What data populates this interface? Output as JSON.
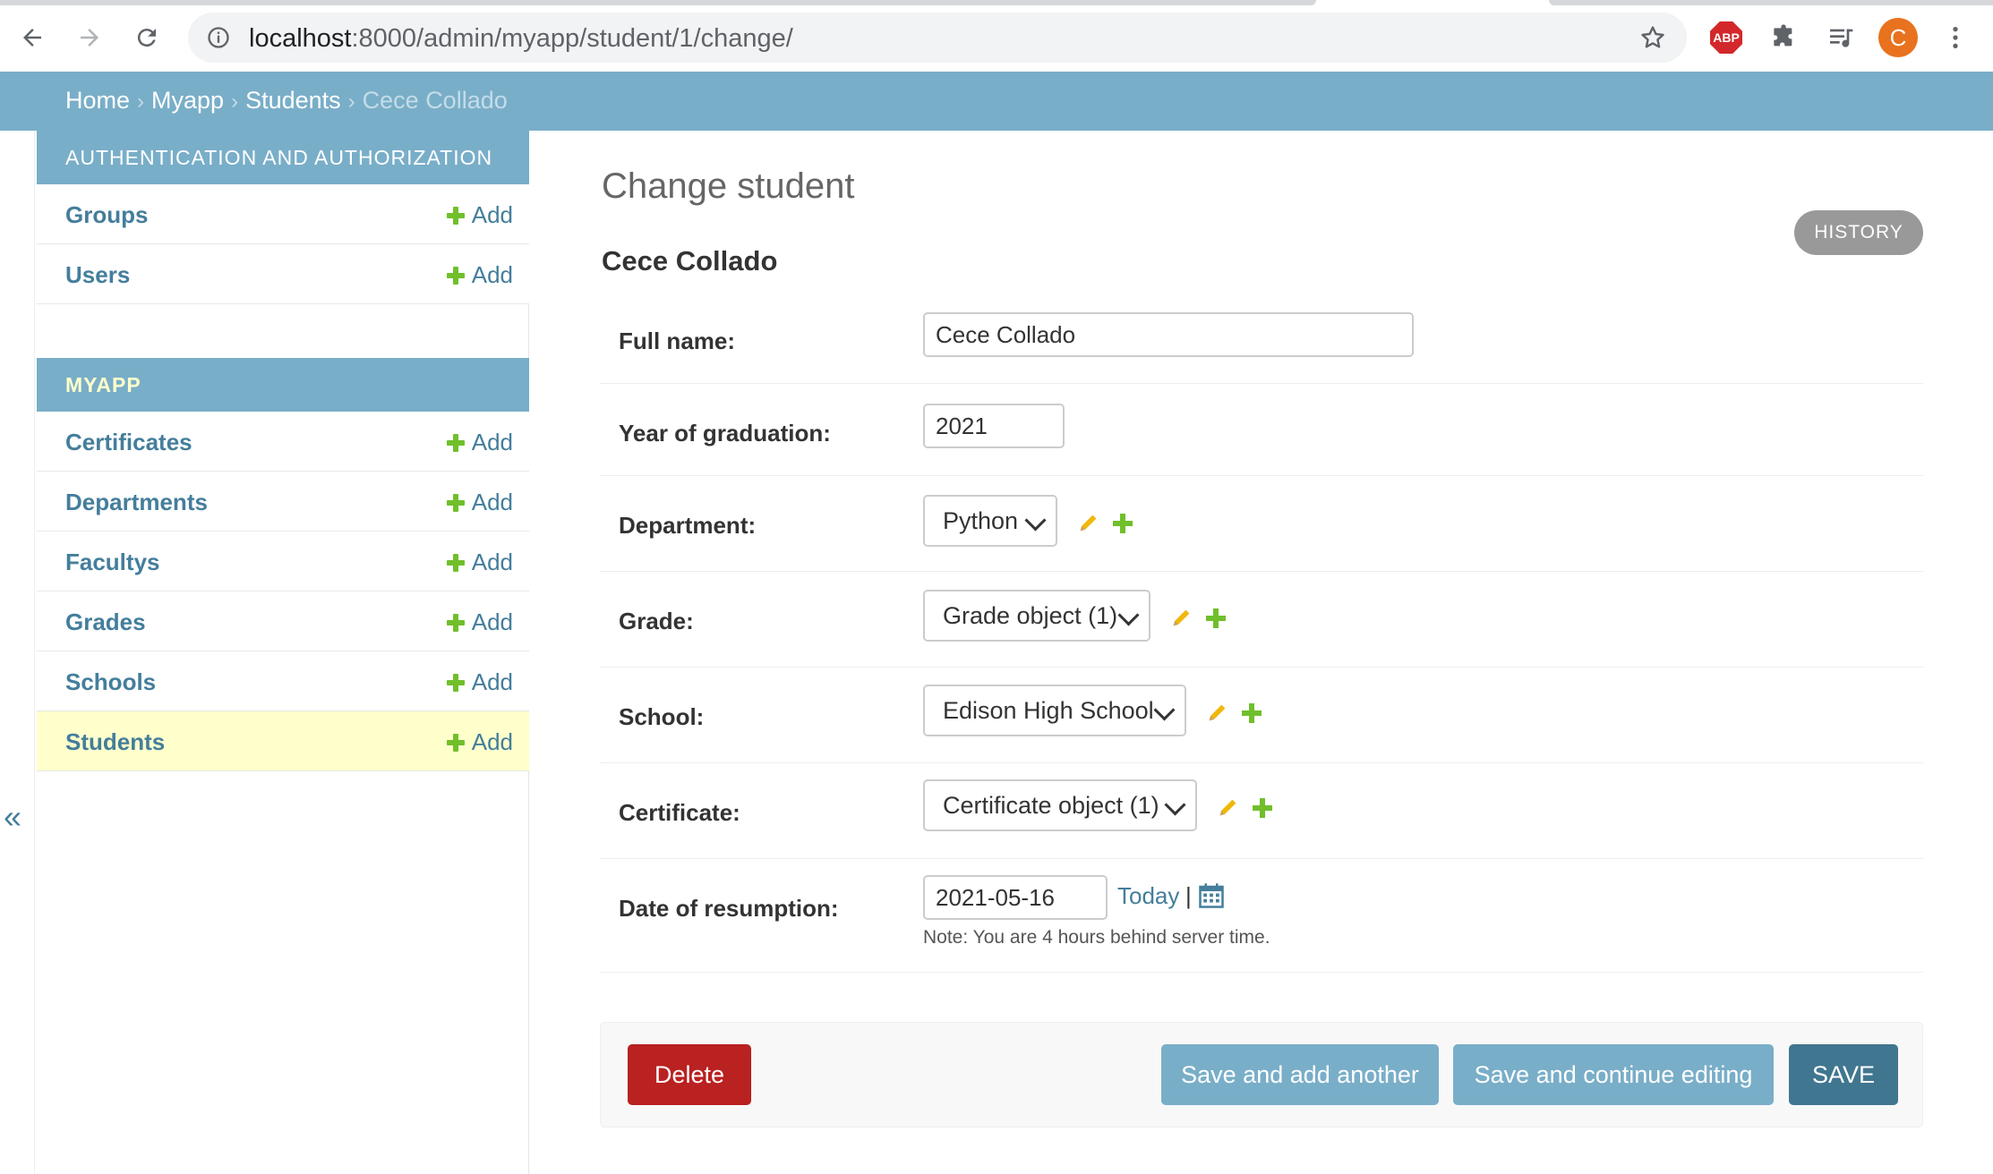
{
  "browser": {
    "url_host": "localhost",
    "url_path": ":8000/admin/myapp/student/1/change/",
    "avatar_letter": "C",
    "abp_label": "ABP"
  },
  "breadcrumbs": {
    "home": "Home",
    "app": "Myapp",
    "model": "Students",
    "current": "Cece Collado",
    "separator": "›"
  },
  "sidebar": {
    "collapse_symbol": "«",
    "modules": [
      {
        "caption": "AUTHENTICATION AND AUTHORIZATION",
        "models": [
          {
            "name": "Groups",
            "add": "Add"
          },
          {
            "name": "Users",
            "add": "Add"
          }
        ]
      },
      {
        "caption": "MYAPP",
        "models": [
          {
            "name": "Certificates",
            "add": "Add"
          },
          {
            "name": "Departments",
            "add": "Add"
          },
          {
            "name": "Facultys",
            "add": "Add"
          },
          {
            "name": "Grades",
            "add": "Add"
          },
          {
            "name": "Schools",
            "add": "Add"
          },
          {
            "name": "Students",
            "add": "Add",
            "active": true
          }
        ]
      }
    ]
  },
  "content": {
    "page_title": "Change student",
    "history_label": "HISTORY",
    "object_title": "Cece Collado",
    "fields": {
      "full_name": {
        "label": "Full name:",
        "value": "Cece Collado"
      },
      "year_of_graduation": {
        "label": "Year of graduation:",
        "value": "2021"
      },
      "department": {
        "label": "Department:",
        "selected": "Python"
      },
      "grade": {
        "label": "Grade:",
        "selected": "Grade object (1)"
      },
      "school": {
        "label": "School:",
        "selected": "Edison High School"
      },
      "certificate": {
        "label": "Certificate:",
        "selected": "Certificate object (1)"
      },
      "date_of_resumption": {
        "label": "Date of resumption:",
        "value": "2021-05-16",
        "today_link": "Today",
        "separator": "|",
        "note": "Note: You are 4 hours behind server time."
      }
    }
  },
  "submit_row": {
    "delete": "Delete",
    "save_add_another": "Save and add another",
    "save_continue": "Save and continue editing",
    "save": "SAVE"
  },
  "colors": {
    "header_blue": "#79aec8",
    "link_blue": "#447e9b",
    "add_green": "#70bf2b",
    "delete_red": "#ba2121",
    "save_dark": "#417690",
    "active_row": "#ffffcc"
  }
}
